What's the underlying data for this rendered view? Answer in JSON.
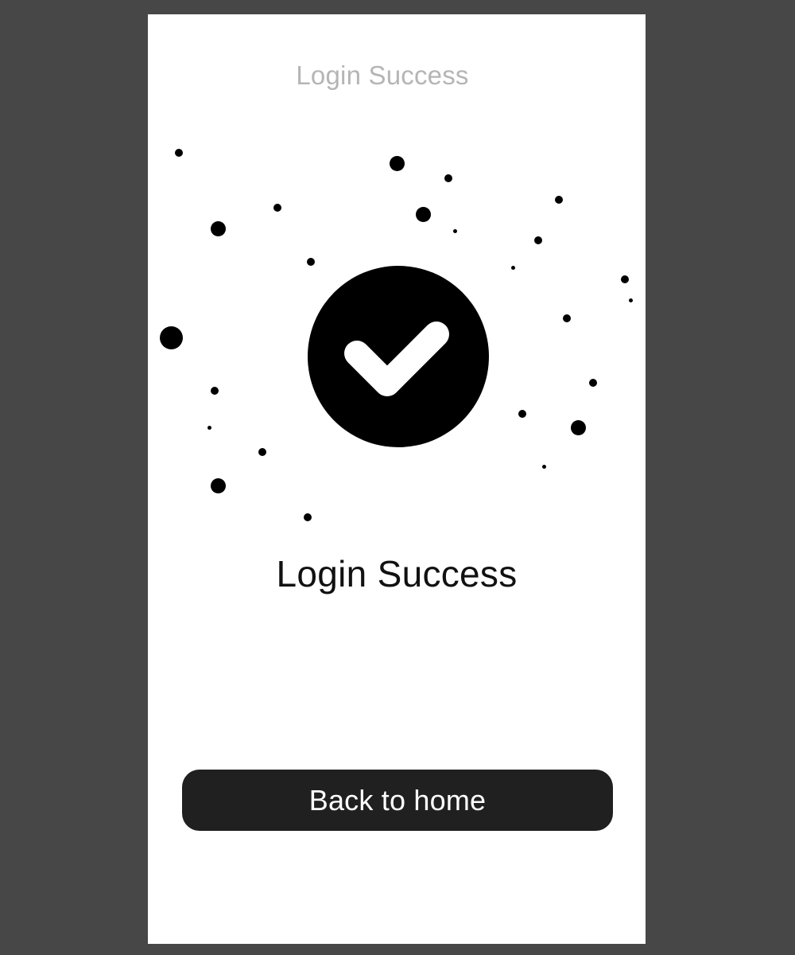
{
  "header": {
    "title": "Login Success"
  },
  "main": {
    "icon": "check-circle-icon",
    "title": "Login Success"
  },
  "actions": {
    "back_home_label": "Back to home"
  },
  "colors": {
    "backdrop": "#474747",
    "screen": "#ffffff",
    "header_text": "#b5b5b5",
    "button_bg": "#202020",
    "button_text": "#ffffff",
    "icon_fill": "#000000"
  }
}
